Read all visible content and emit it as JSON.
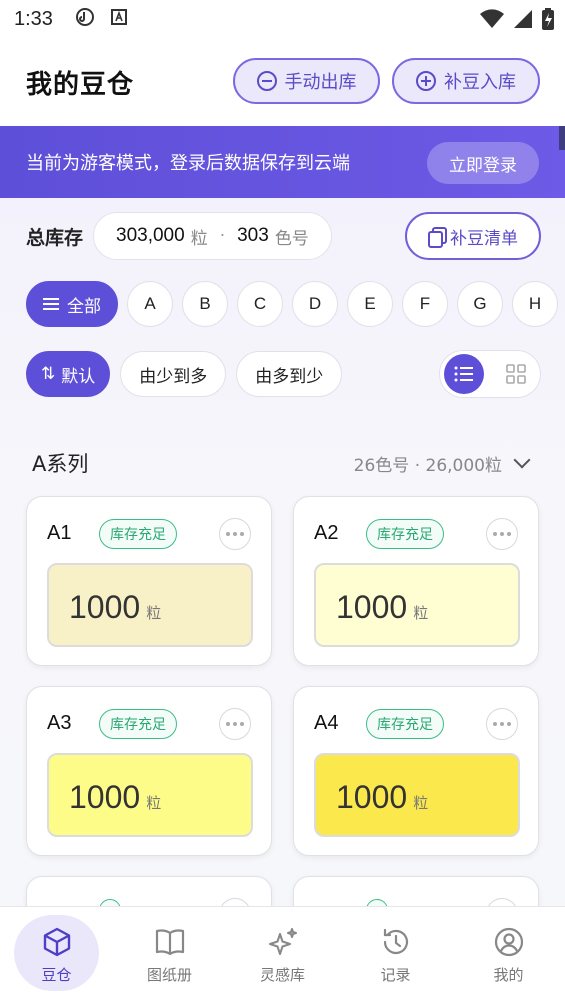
{
  "status_bar": {
    "time": "1:33"
  },
  "header": {
    "title": "我的豆仓",
    "btn_out": "手动出库",
    "btn_in": "补豆入库"
  },
  "banner": {
    "text": "当前为游客模式，登录后数据保存到云端",
    "login": "立即登录"
  },
  "inventory": {
    "label": "总库存",
    "beans": "303,000",
    "bean_unit": "粒",
    "colors": "303",
    "color_unit": "色号",
    "list_btn": "补豆清单"
  },
  "filters": {
    "all": "全部",
    "letters": [
      "A",
      "B",
      "C",
      "D",
      "E",
      "F",
      "G",
      "H"
    ]
  },
  "sort": {
    "default": "默认",
    "asc": "由少到多",
    "desc": "由多到少"
  },
  "series": {
    "name": "A系列",
    "meta": "26色号 · 26,000粒"
  },
  "cards": [
    {
      "code": "A1",
      "badge": "库存充足",
      "qty": "1000",
      "unit": "粒",
      "color": "#f8f1c8"
    },
    {
      "code": "A2",
      "badge": "库存充足",
      "qty": "1000",
      "unit": "粒",
      "color": "#fffdd2"
    },
    {
      "code": "A3",
      "badge": "库存充足",
      "qty": "1000",
      "unit": "粒",
      "color": "#fdfc88"
    },
    {
      "code": "A4",
      "badge": "库存充足",
      "qty": "1000",
      "unit": "粒",
      "color": "#fbe84c"
    },
    {
      "code": "",
      "badge": "",
      "qty": "",
      "unit": "",
      "color": "#ffffff"
    },
    {
      "code": "",
      "badge": "",
      "qty": "",
      "unit": "",
      "color": "#ffffff"
    }
  ],
  "tabs": [
    {
      "label": "豆仓",
      "icon": "cube-icon",
      "active": true
    },
    {
      "label": "图纸册",
      "icon": "book-icon",
      "active": false
    },
    {
      "label": "灵感库",
      "icon": "sparkle-icon",
      "active": false
    },
    {
      "label": "记录",
      "icon": "history-icon",
      "active": false
    },
    {
      "label": "我的",
      "icon": "user-icon",
      "active": false
    }
  ],
  "colors": {
    "accent": "#5e4fd8",
    "success": "#2aa872"
  }
}
